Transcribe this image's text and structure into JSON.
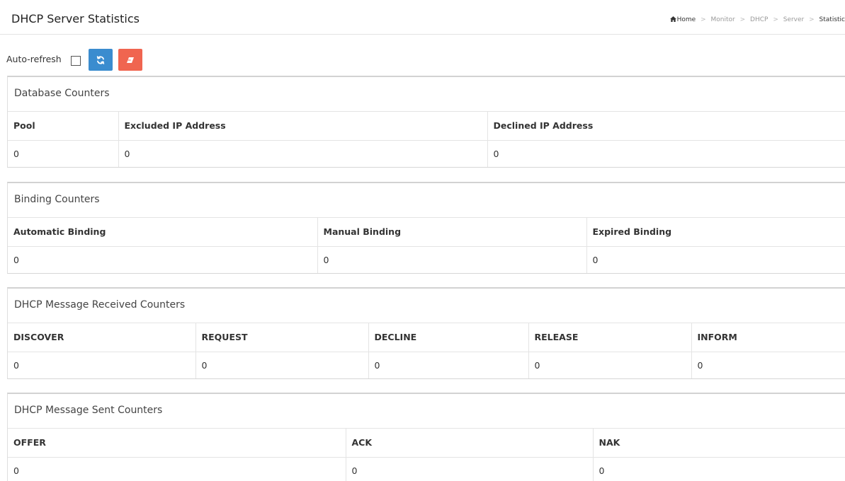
{
  "header": {
    "title": "DHCP Server Statistics",
    "breadcrumb": {
      "home": "Home",
      "items": [
        "Monitor",
        "DHCP",
        "Server"
      ],
      "current": "Statistic"
    }
  },
  "toolbar": {
    "auto_refresh_label": "Auto-refresh",
    "auto_refresh_checked": false,
    "refresh_icon": "refresh-icon",
    "clear_icon": "eraser-icon",
    "refresh_color": "#3a8ccf",
    "clear_color": "#f06550"
  },
  "database_counters": {
    "title": "Database Counters",
    "headers": [
      "Pool",
      "Excluded IP Address",
      "Declined IP Address"
    ],
    "values": [
      "0",
      "0",
      "0"
    ]
  },
  "binding_counters": {
    "title": "Binding Counters",
    "headers": [
      "Automatic Binding",
      "Manual Binding",
      "Expired Binding"
    ],
    "values": [
      "0",
      "0",
      "0"
    ]
  },
  "received_counters": {
    "title": "DHCP Message Received Counters",
    "headers": [
      "DISCOVER",
      "REQUEST",
      "DECLINE",
      "RELEASE",
      "INFORM"
    ],
    "values": [
      "0",
      "0",
      "0",
      "0",
      "0"
    ]
  },
  "sent_counters": {
    "title": "DHCP Message Sent Counters",
    "headers": [
      "OFFER",
      "ACK",
      "NAK"
    ],
    "values": [
      "0",
      "0",
      "0"
    ]
  }
}
